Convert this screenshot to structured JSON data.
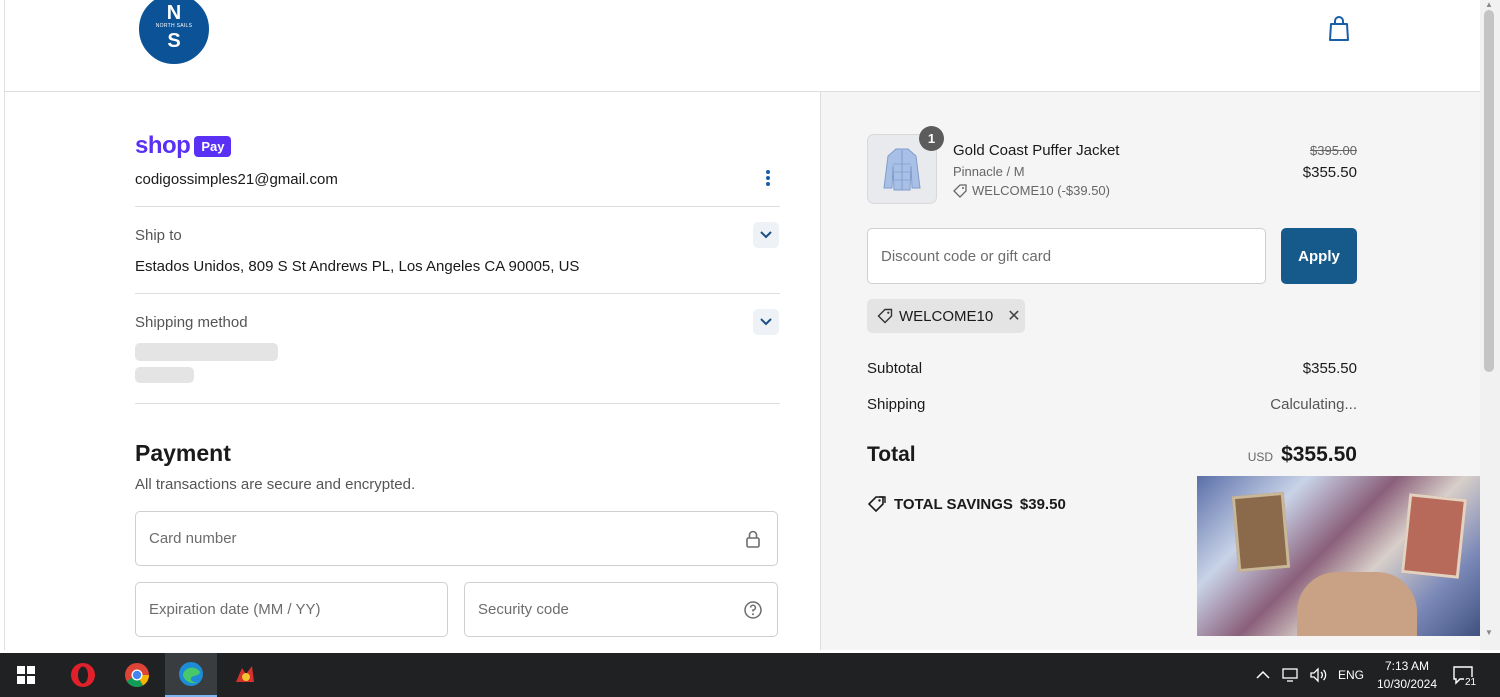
{
  "brand": {
    "logo_top": "N",
    "logo_mid": "NORTH SAILS",
    "logo_bottom": "S"
  },
  "contact": {
    "shop_text": "shop",
    "pay_text": "Pay",
    "email": "codigossimples21@gmail.com"
  },
  "ship_to": {
    "label": "Ship to",
    "value": "Estados Unidos, 809 S St Andrews PL, Los Angeles CA 90005, US"
  },
  "shipping_method": {
    "label": "Shipping method"
  },
  "payment": {
    "title": "Payment",
    "subtitle": "All transactions are secure and encrypted.",
    "card_number_placeholder": "Card number",
    "expiry_placeholder": "Expiration date (MM / YY)",
    "security_placeholder": "Security code"
  },
  "order": {
    "item": {
      "quantity": "1",
      "name": "Gold Coast Puffer Jacket",
      "variant": "Pinnacle / M",
      "discount": "WELCOME10 (-$39.50)",
      "original_price": "$395.00",
      "price": "$355.50"
    },
    "discount_placeholder": "Discount code or gift card",
    "apply_label": "Apply",
    "applied_code": "WELCOME10",
    "subtotal_label": "Subtotal",
    "subtotal_value": "$355.50",
    "shipping_label": "Shipping",
    "shipping_value": "Calculating...",
    "total_label": "Total",
    "currency": "USD",
    "total_value": "$355.50",
    "savings_label": "TOTAL SAVINGS",
    "savings_value": "$39.50"
  },
  "taskbar": {
    "language": "ENG",
    "time": "7:13 AM",
    "date": "10/30/2024",
    "notifications": "21"
  },
  "colors": {
    "shop_pay": "#5a31f4",
    "apply_button": "#165a8c",
    "brand_blue": "#0b5296"
  }
}
